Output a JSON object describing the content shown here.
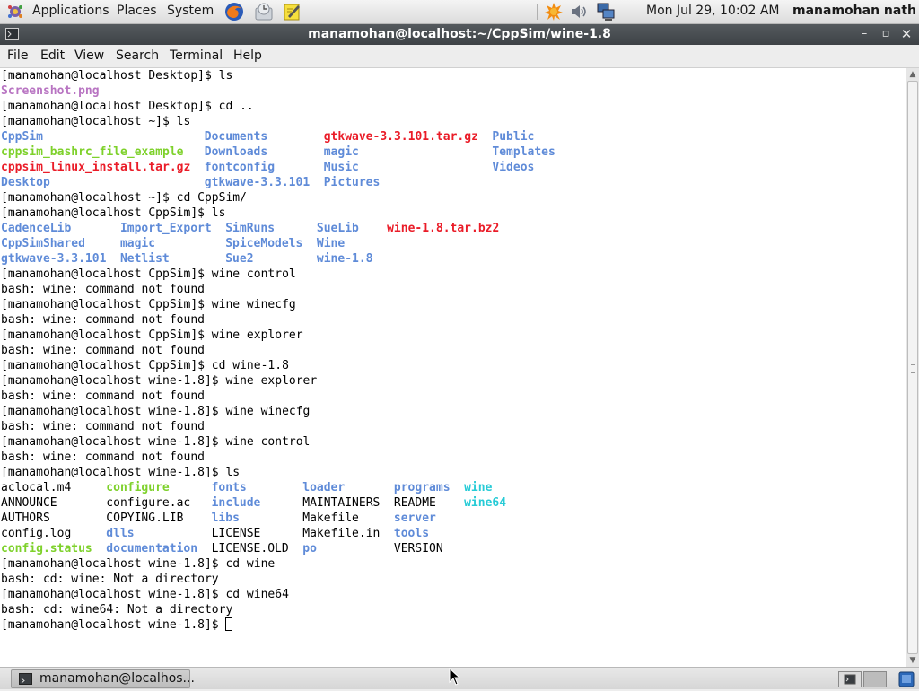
{
  "top_panel": {
    "menus": [
      "Applications",
      "Places",
      "System"
    ],
    "clock": "Mon Jul 29, 10:02 AM",
    "user": "manamohan nath",
    "launchers": [
      "firefox-icon",
      "mail-client-icon",
      "notes-icon"
    ],
    "tray": [
      "update-notifier-icon",
      "volume-icon",
      "network-icon"
    ]
  },
  "window": {
    "title": "manamohan@localhost:~/CppSim/wine-1.8",
    "controls": [
      "minimize",
      "maximize",
      "close"
    ]
  },
  "menubar": [
    "File",
    "Edit",
    "View",
    "Search",
    "Terminal",
    "Help"
  ],
  "terminal": {
    "lines": [
      {
        "t": "[manamohan@localhost Desktop]$ ls"
      },
      {
        "cols": [
          {
            "x": 0,
            "t": "Screenshot.png",
            "c": "img"
          }
        ]
      },
      {
        "t": "[manamohan@localhost Desktop]$ cd .."
      },
      {
        "t": "[manamohan@localhost ~]$ ls"
      },
      {
        "cols": [
          {
            "x": 0,
            "t": "CppSim",
            "c": "dir"
          },
          {
            "x": 29,
            "t": "Documents",
            "c": "dir"
          },
          {
            "x": 46,
            "t": "gtkwave-3.3.101.tar.gz",
            "c": "arc"
          },
          {
            "x": 70,
            "t": "Public",
            "c": "dir"
          }
        ]
      },
      {
        "cols": [
          {
            "x": 0,
            "t": "cppsim_bashrc_file_example",
            "c": "exe"
          },
          {
            "x": 29,
            "t": "Downloads",
            "c": "dir"
          },
          {
            "x": 46,
            "t": "magic",
            "c": "dir"
          },
          {
            "x": 70,
            "t": "Templates",
            "c": "dir"
          }
        ]
      },
      {
        "cols": [
          {
            "x": 0,
            "t": "cppsim_linux_install.tar.gz",
            "c": "arc"
          },
          {
            "x": 29,
            "t": "fontconfig",
            "c": "dir"
          },
          {
            "x": 46,
            "t": "Music",
            "c": "dir"
          },
          {
            "x": 70,
            "t": "Videos",
            "c": "dir"
          }
        ]
      },
      {
        "cols": [
          {
            "x": 0,
            "t": "Desktop",
            "c": "dir"
          },
          {
            "x": 29,
            "t": "gtkwave-3.3.101",
            "c": "dir"
          },
          {
            "x": 46,
            "t": "Pictures",
            "c": "dir"
          }
        ]
      },
      {
        "t": "[manamohan@localhost ~]$ cd CppSim/"
      },
      {
        "t": "[manamohan@localhost CppSim]$ ls"
      },
      {
        "cols": [
          {
            "x": 0,
            "t": "CadenceLib",
            "c": "dir"
          },
          {
            "x": 17,
            "t": "Import_Export",
            "c": "dir"
          },
          {
            "x": 32,
            "t": "SimRuns",
            "c": "dir"
          },
          {
            "x": 45,
            "t": "SueLib",
            "c": "dir"
          },
          {
            "x": 55,
            "t": "wine-1.8.tar.bz2",
            "c": "arc"
          }
        ]
      },
      {
        "cols": [
          {
            "x": 0,
            "t": "CppSimShared",
            "c": "dir"
          },
          {
            "x": 17,
            "t": "magic",
            "c": "dir"
          },
          {
            "x": 32,
            "t": "SpiceModels",
            "c": "dir"
          },
          {
            "x": 45,
            "t": "Wine",
            "c": "dir"
          }
        ]
      },
      {
        "cols": [
          {
            "x": 0,
            "t": "gtkwave-3.3.101",
            "c": "dir"
          },
          {
            "x": 17,
            "t": "Netlist",
            "c": "dir"
          },
          {
            "x": 32,
            "t": "Sue2",
            "c": "dir"
          },
          {
            "x": 45,
            "t": "wine-1.8",
            "c": "dir"
          }
        ]
      },
      {
        "t": "[manamohan@localhost CppSim]$ wine control"
      },
      {
        "t": "bash: wine: command not found"
      },
      {
        "t": "[manamohan@localhost CppSim]$ wine winecfg"
      },
      {
        "t": "bash: wine: command not found"
      },
      {
        "t": "[manamohan@localhost CppSim]$ wine explorer"
      },
      {
        "t": "bash: wine: command not found"
      },
      {
        "t": "[manamohan@localhost CppSim]$ cd wine-1.8"
      },
      {
        "t": "[manamohan@localhost wine-1.8]$ wine explorer"
      },
      {
        "t": "bash: wine: command not found"
      },
      {
        "t": "[manamohan@localhost wine-1.8]$ wine winecfg"
      },
      {
        "t": "bash: wine: command not found"
      },
      {
        "t": "[manamohan@localhost wine-1.8]$ wine control"
      },
      {
        "t": "bash: wine: command not found"
      },
      {
        "t": "[manamohan@localhost wine-1.8]$ ls"
      },
      {
        "cols": [
          {
            "x": 0,
            "t": "aclocal.m4",
            "c": ""
          },
          {
            "x": 15,
            "t": "configure",
            "c": "exe"
          },
          {
            "x": 30,
            "t": "fonts",
            "c": "dir"
          },
          {
            "x": 43,
            "t": "loader",
            "c": "dir"
          },
          {
            "x": 56,
            "t": "programs",
            "c": "dir"
          },
          {
            "x": 66,
            "t": "wine",
            "c": "lnk"
          }
        ]
      },
      {
        "cols": [
          {
            "x": 0,
            "t": "ANNOUNCE",
            "c": ""
          },
          {
            "x": 15,
            "t": "configure.ac",
            "c": ""
          },
          {
            "x": 30,
            "t": "include",
            "c": "dir"
          },
          {
            "x": 43,
            "t": "MAINTAINERS",
            "c": ""
          },
          {
            "x": 56,
            "t": "README",
            "c": ""
          },
          {
            "x": 66,
            "t": "wine64",
            "c": "lnk"
          }
        ]
      },
      {
        "cols": [
          {
            "x": 0,
            "t": "AUTHORS",
            "c": ""
          },
          {
            "x": 15,
            "t": "COPYING.LIB",
            "c": ""
          },
          {
            "x": 30,
            "t": "libs",
            "c": "dir"
          },
          {
            "x": 43,
            "t": "Makefile",
            "c": ""
          },
          {
            "x": 56,
            "t": "server",
            "c": "dir"
          }
        ]
      },
      {
        "cols": [
          {
            "x": 0,
            "t": "config.log",
            "c": ""
          },
          {
            "x": 15,
            "t": "dlls",
            "c": "dir"
          },
          {
            "x": 30,
            "t": "LICENSE",
            "c": ""
          },
          {
            "x": 43,
            "t": "Makefile.in",
            "c": ""
          },
          {
            "x": 56,
            "t": "tools",
            "c": "dir"
          }
        ]
      },
      {
        "cols": [
          {
            "x": 0,
            "t": "config.status",
            "c": "exe"
          },
          {
            "x": 15,
            "t": "documentation",
            "c": "dir"
          },
          {
            "x": 30,
            "t": "LICENSE.OLD",
            "c": ""
          },
          {
            "x": 43,
            "t": "po",
            "c": "dir"
          },
          {
            "x": 56,
            "t": "VERSION",
            "c": ""
          }
        ]
      },
      {
        "t": "[manamohan@localhost wine-1.8]$ cd wine"
      },
      {
        "t": "bash: cd: wine: Not a directory"
      },
      {
        "t": "[manamohan@localhost wine-1.8]$ cd wine64"
      },
      {
        "t": "bash: cd: wine64: Not a directory"
      },
      {
        "t": "[manamohan@localhost wine-1.8]$ ",
        "cursor": true
      }
    ]
  },
  "taskbar": {
    "task_label": "manamohan@localhos..."
  },
  "colors": {
    "directory": "#5f8bd8",
    "executable": "#7ed12b",
    "archive": "#ea1c28",
    "image": "#b874c2",
    "symlink": "#27cbd6"
  }
}
